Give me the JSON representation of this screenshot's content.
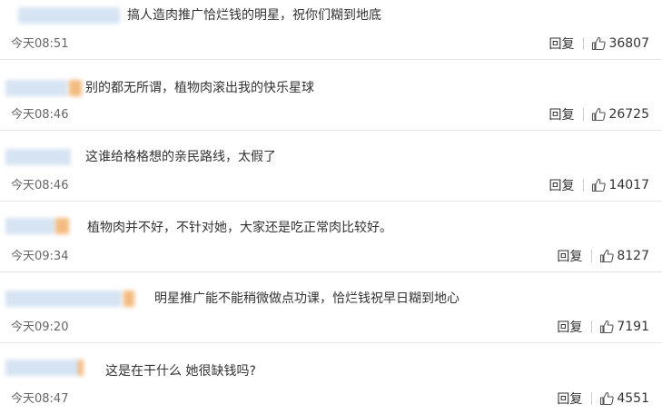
{
  "comments": [
    {
      "text": "搞人造肉推广恰烂钱的明星，祝你们糊到地底",
      "time": "今天08:51",
      "reply": "回复",
      "likes": "36807"
    },
    {
      "text": "别的都无所谓，植物肉滚出我的快乐星球",
      "time": "今天08:46",
      "reply": "回复",
      "likes": "26725"
    },
    {
      "text": "这谁给格格想的亲民路线，太假了",
      "time": "今天08:46",
      "reply": "回复",
      "likes": "14017"
    },
    {
      "text": "植物肉并不好，不针对她，大家还是吃正常肉比较好。",
      "time": "今天09:34",
      "reply": "回复",
      "likes": "8127"
    },
    {
      "text": "明星推广能不能稍微做点功课，恰烂钱祝早日糊到地心",
      "time": "今天09:20",
      "reply": "回复",
      "likes": "7191"
    },
    {
      "text": "这是在干什么 她很缺钱吗?",
      "time": "今天08:47",
      "reply": "回复",
      "likes": "4551"
    }
  ],
  "icons": {
    "like": "thumbs-up-icon"
  },
  "colors": {
    "blur_blue": "#c9dbef",
    "blur_orange": "#f2b06b",
    "divider": "#e6e6e6"
  }
}
